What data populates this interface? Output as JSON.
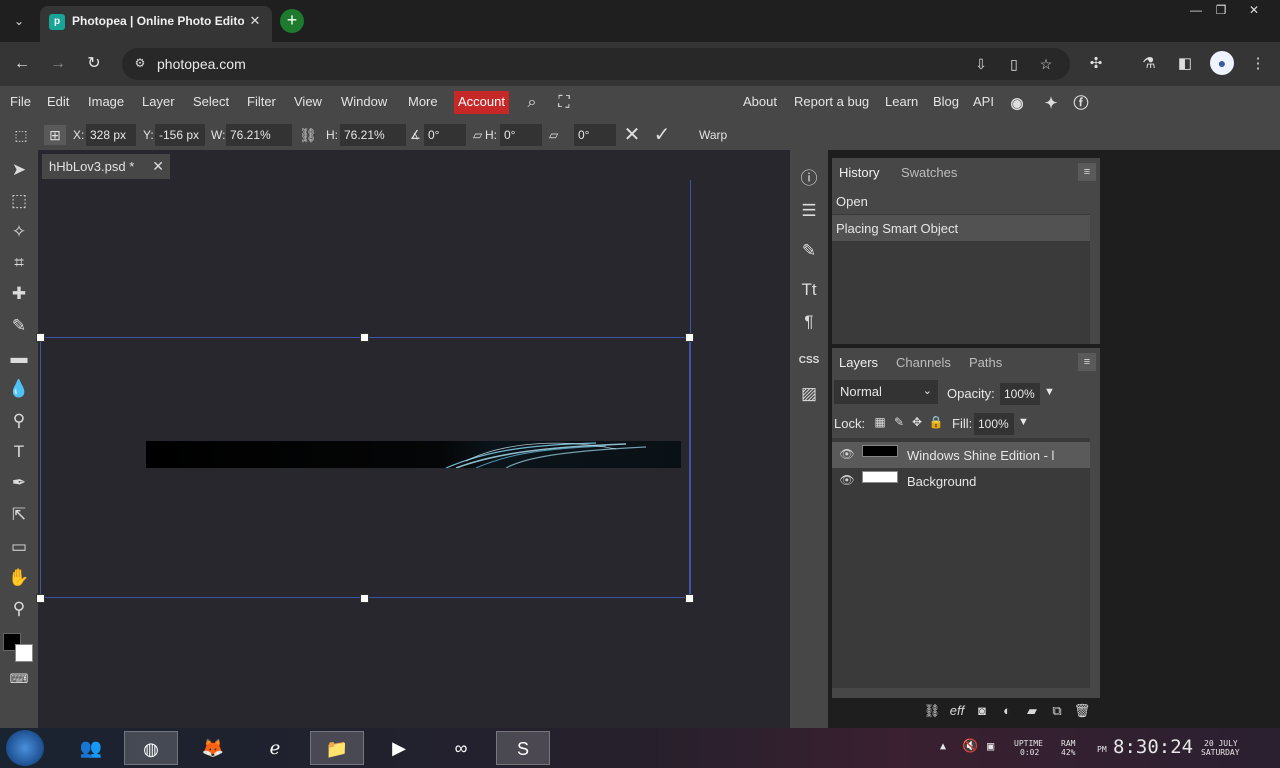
{
  "browser": {
    "tab_title": "Photopea | Online Photo Editor",
    "favicon": "photopea-icon",
    "url": "photopea.com"
  },
  "menubar": {
    "items": [
      "File",
      "Edit",
      "Image",
      "Layer",
      "Select",
      "Filter",
      "View",
      "Window",
      "More"
    ],
    "account": "Account",
    "right_links": [
      "About",
      "Report a bug",
      "Learn",
      "Blog",
      "API"
    ]
  },
  "options": {
    "x_label": "X:",
    "x_value": "328 px",
    "y_label": "Y:",
    "y_value": "-156 px",
    "w_label": "W:",
    "w_value": "76.21%",
    "h_label": "H:",
    "h_value": "76.21%",
    "angle_value": "0°",
    "skew_h_label": "H:",
    "skew_h_value": "0°",
    "skew_v_value": "0°",
    "warp_label": "Warp"
  },
  "document": {
    "tab_name": "hHbLov3.psd *"
  },
  "history": {
    "tabs": [
      "History",
      "Swatches"
    ],
    "items": [
      "Open",
      "Placing Smart Object"
    ]
  },
  "layers": {
    "tabs": [
      "Layers",
      "Channels",
      "Paths"
    ],
    "blend_mode": "Normal",
    "opacity_label": "Opacity:",
    "opacity_value": "100%",
    "lock_label": "Lock:",
    "fill_label": "Fill:",
    "fill_value": "100%",
    "items": [
      "Windows Shine Edition - l",
      "Background"
    ]
  },
  "taskbar": {
    "uptime_label": "UPTIME",
    "uptime_value": "0:02",
    "ram_label": "RAM",
    "ram_value": "42%",
    "ampm": "PM",
    "time": "8:30:24",
    "date_line1": "20 JULY",
    "date_line2": "SATURDAY"
  },
  "colors": {
    "account_bg": "#c62828",
    "selection_line": "#3f54a9",
    "panel_bg": "#474747"
  }
}
